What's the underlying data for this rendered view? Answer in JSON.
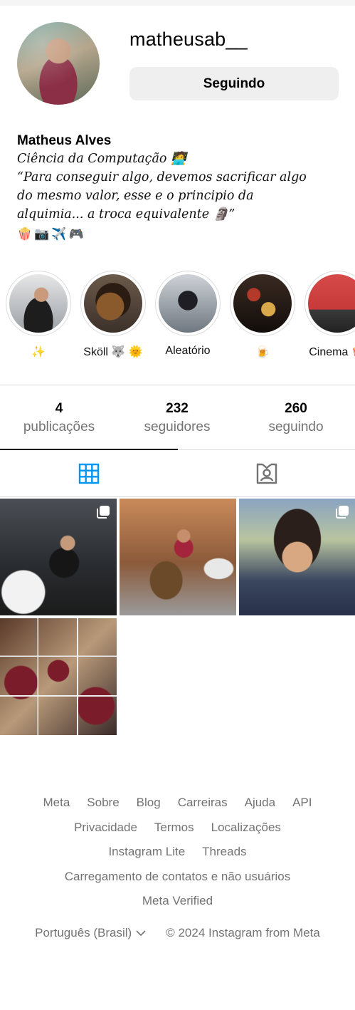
{
  "profile": {
    "username": "matheusab__",
    "follow_button_label": "Seguindo",
    "full_name": "Matheus Alves",
    "bio_lines": [
      "Ciência da Computação 🧑‍💻",
      "“Para conseguir algo, devemos sacrificar algo",
      "do mesmo valor, esse e o principio da",
      "alquimia... a troca equivalente 🗿”"
    ],
    "bio_emojis": "🍿📷✈️🎮"
  },
  "highlights": [
    {
      "label": "✨"
    },
    {
      "label": "Sköll 🐺 🌞"
    },
    {
      "label": "Aleatório"
    },
    {
      "label": "🍺"
    },
    {
      "label": "Cinema 🍿"
    }
  ],
  "stats": {
    "posts_count": "4",
    "posts_label": "publicações",
    "followers_count": "232",
    "followers_label": "seguidores",
    "following_count": "260",
    "following_label": "seguindo"
  },
  "tabs": [
    {
      "name": "posts-grid",
      "icon": "grid-icon",
      "active": true,
      "color": "#0095f6"
    },
    {
      "name": "tagged",
      "icon": "tagged-user-icon",
      "active": false,
      "color": "#737373"
    }
  ],
  "posts": [
    {
      "multi": true
    },
    {
      "multi": false
    },
    {
      "multi": true
    },
    {
      "multi": false
    }
  ],
  "footer": {
    "rows": [
      [
        "Meta",
        "Sobre",
        "Blog",
        "Carreiras",
        "Ajuda",
        "API"
      ],
      [
        "Privacidade",
        "Termos",
        "Localizações"
      ],
      [
        "Instagram Lite",
        "Threads"
      ],
      [
        "Carregamento de contatos e não usuários"
      ],
      [
        "Meta Verified"
      ]
    ],
    "language": "Português (Brasil)",
    "copyright": "© 2024 Instagram from Meta"
  },
  "colors": {
    "accent": "#0095f6",
    "muted": "#737373",
    "button_bg": "#efefef",
    "divider": "#dbdbdb"
  }
}
